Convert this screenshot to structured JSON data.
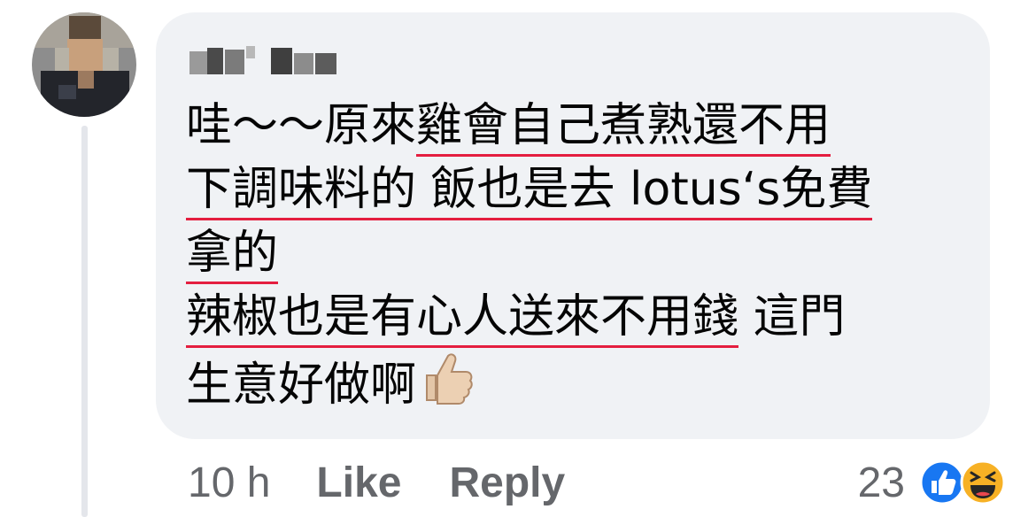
{
  "comment": {
    "lines": [
      {
        "plain": "哇～～原來",
        "underlined": "雞會自己煮熟還不用",
        "after": ""
      },
      {
        "plain": "",
        "underlined": "下調味料的 飯也是去 lotus‘s免費",
        "after": ""
      },
      {
        "plain": "",
        "underlined": "拿的",
        "after": ""
      },
      {
        "plain": "",
        "underlined": "辣椒也是有心人送來不用錢",
        "after": " 這門"
      },
      {
        "plain": "生意好做啊",
        "underlined": "",
        "after": ""
      }
    ],
    "emoji": "thumbs-up-icon"
  },
  "actions": {
    "time": "10 h",
    "like": "Like",
    "reply": "Reply"
  },
  "reactions": {
    "count": "23",
    "icons": [
      "like-reaction-icon",
      "haha-reaction-icon"
    ]
  },
  "colors": {
    "bubble": "#f0f2f5",
    "underline": "#e41e3f",
    "secondary_text": "#65676b",
    "like_blue": "#1877f2",
    "haha_yellow": "#f7b125"
  }
}
